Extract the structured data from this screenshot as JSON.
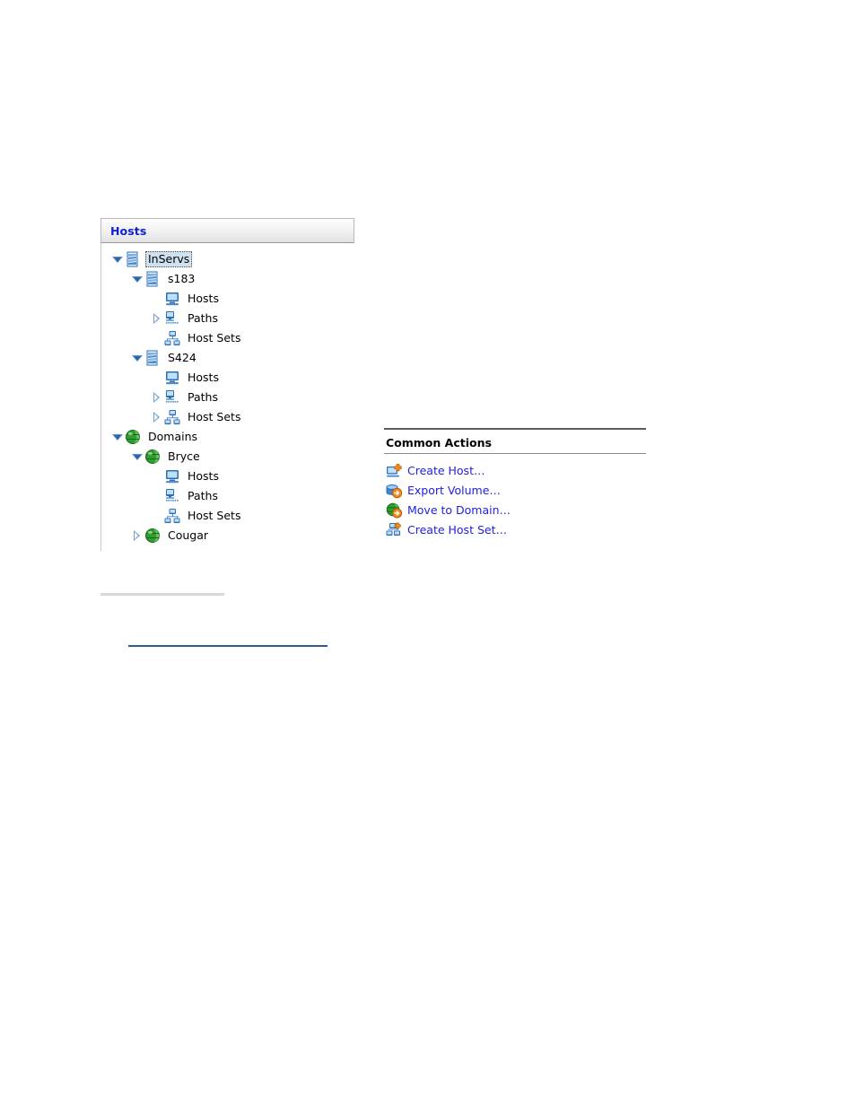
{
  "tree_panel": {
    "header_title": "Hosts",
    "nodes": [
      {
        "label": "InServs",
        "level": 0,
        "toggle": "open",
        "icon": "inserv-icon",
        "selected": true
      },
      {
        "label": "s183",
        "level": 1,
        "toggle": "open",
        "icon": "inserv-icon",
        "selected": false
      },
      {
        "label": "Hosts",
        "level": 2,
        "toggle": "none",
        "icon": "host-icon",
        "selected": false
      },
      {
        "label": "Paths",
        "level": 2,
        "toggle": "closed",
        "icon": "path-icon",
        "selected": false
      },
      {
        "label": "Host Sets",
        "level": 2,
        "toggle": "none",
        "icon": "hostset-icon",
        "selected": false
      },
      {
        "label": "S424",
        "level": 1,
        "toggle": "open",
        "icon": "inserv-icon",
        "selected": false
      },
      {
        "label": "Hosts",
        "level": 2,
        "toggle": "none",
        "icon": "host-icon",
        "selected": false
      },
      {
        "label": "Paths",
        "level": 2,
        "toggle": "closed",
        "icon": "path-icon",
        "selected": false
      },
      {
        "label": "Host Sets",
        "level": 2,
        "toggle": "closed",
        "icon": "hostset-icon",
        "selected": false
      },
      {
        "label": "Domains",
        "level": 0,
        "toggle": "open",
        "icon": "domain-icon",
        "selected": false
      },
      {
        "label": "Bryce",
        "level": 1,
        "toggle": "open",
        "icon": "domain-icon",
        "selected": false
      },
      {
        "label": "Hosts",
        "level": 2,
        "toggle": "none",
        "icon": "host-icon",
        "selected": false
      },
      {
        "label": "Paths",
        "level": 2,
        "toggle": "none",
        "icon": "path-icon",
        "selected": false
      },
      {
        "label": "Host Sets",
        "level": 2,
        "toggle": "none",
        "icon": "hostset-icon",
        "selected": false
      },
      {
        "label": "Cougar",
        "level": 1,
        "toggle": "closed",
        "icon": "domain-icon",
        "selected": false
      }
    ]
  },
  "common_actions": {
    "title": "Common Actions",
    "items": [
      {
        "label": "Create Host…",
        "icon": "create-host-icon"
      },
      {
        "label": "Export Volume…",
        "icon": "export-volume-icon"
      },
      {
        "label": "Move to Domain…",
        "icon": "move-to-domain-icon"
      },
      {
        "label": "Create Host Set…",
        "icon": "create-host-set-icon"
      }
    ]
  },
  "colors": {
    "header_title": "#1020d8",
    "link": "#2020e0",
    "selection": "#cfe0f0",
    "rule_blue": "#2c5d8f",
    "rule_gray": "#d9d9d9",
    "domain_green": "#2e9c2e",
    "icon_blue": "#2f6fba",
    "accent_orange": "#f08a1e"
  }
}
